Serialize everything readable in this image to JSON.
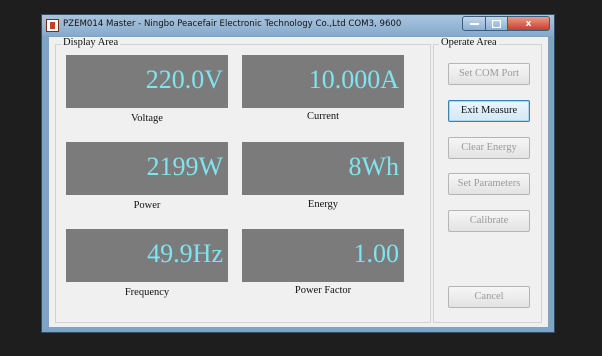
{
  "window": {
    "title": "PZEM014 Master - Ningbo Peacefair Electronic Technology Co.,Ltd   COM3, 9600",
    "close_glyph": "x"
  },
  "display_area": {
    "label": "Display Area",
    "readouts": [
      {
        "value": "220.0V",
        "caption": "Voltage"
      },
      {
        "value": "10.000A",
        "caption": "Current"
      },
      {
        "value": "2199W",
        "caption": "Power"
      },
      {
        "value": "8Wh",
        "caption": "Energy"
      },
      {
        "value": "49.9Hz",
        "caption": "Frequency"
      },
      {
        "value": "1.00",
        "caption": "Power Factor"
      }
    ]
  },
  "operate_area": {
    "label": "Operate Area",
    "buttons": [
      {
        "label": "Set COM Port",
        "enabled": false
      },
      {
        "label": "Exit Measure",
        "enabled": true
      },
      {
        "label": "Clear Energy",
        "enabled": false
      },
      {
        "label": "Set Parameters",
        "enabled": false
      },
      {
        "label": "Calibrate",
        "enabled": false
      },
      {
        "label": "Cancel",
        "enabled": false
      }
    ]
  },
  "colors": {
    "readout_background": "#7b7b7b",
    "readout_text": "#7fe4ef",
    "title_bar": "#86aacb",
    "close_button": "#c3402a"
  }
}
